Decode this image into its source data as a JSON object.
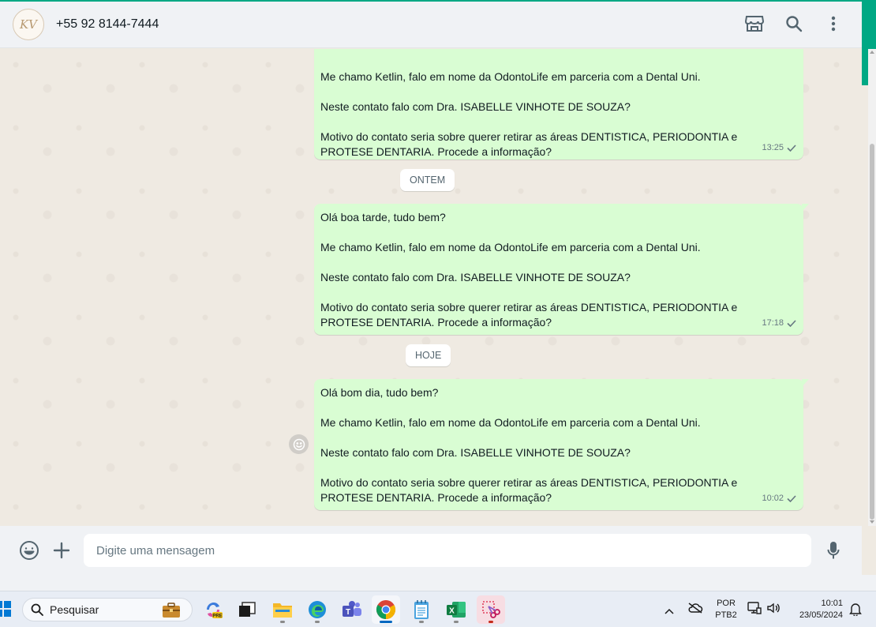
{
  "header": {
    "avatar_initials": "KV",
    "contact_name": "+55 92 8144-7444",
    "icons": [
      "store-icon",
      "search-icon",
      "menu-dots-icon"
    ]
  },
  "chat": {
    "messages": [
      {
        "lines": [
          "Me chamo Ketlin, falo em nome da OdontoLife em parceria com a Dental Uni.",
          "Neste contato falo com Dra. ISABELLE VINHOTE DE SOUZA?",
          "Motivo do contato seria sobre querer retirar as áreas DENTISTICA, PERIODONTIA e PROTESE DENTARIA. Procede a informação?"
        ],
        "time": "13:25"
      },
      {
        "lines": [
          "Olá boa tarde, tudo bem?",
          "Me chamo Ketlin, falo em nome da OdontoLife em parceria com a Dental Uni.",
          "Neste contato falo com Dra. ISABELLE VINHOTE DE SOUZA?",
          "Motivo do contato seria sobre querer retirar as áreas DENTISTICA, PERIODONTIA e PROTESE DENTARIA. Procede a informação?"
        ],
        "time": "17:18"
      },
      {
        "lines": [
          "Olá bom dia, tudo bem?",
          "Me chamo Ketlin, falo em nome da OdontoLife em parceria com a Dental Uni.",
          "Neste contato falo com Dra. ISABELLE VINHOTE DE SOUZA?",
          "Motivo do contato seria sobre querer retirar as áreas DENTISTICA, PERIODONTIA e PROTESE DENTARIA. Procede a informação?"
        ],
        "time": "10:02"
      }
    ],
    "date_separators": [
      "ONTEM",
      "HOJE"
    ]
  },
  "composer": {
    "placeholder": "Digite uma mensagem"
  },
  "taskbar": {
    "search_label": "Pesquisar",
    "language_top": "POR",
    "language_bottom": "PTB2",
    "time": "10:01",
    "date": "23/05/2024"
  },
  "colors": {
    "accent": "#00a884",
    "outgoing_bubble": "#d9fdd3",
    "chat_background": "#efeae2",
    "header_background": "#f0f2f5"
  }
}
